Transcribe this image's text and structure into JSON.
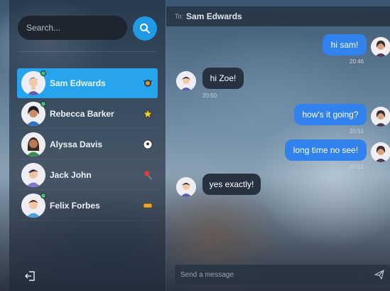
{
  "search": {
    "placeholder": "Search..."
  },
  "contacts": [
    {
      "name": "Sam Edwards",
      "active": true,
      "online": true,
      "emoji": "bug-icon"
    },
    {
      "name": "Rebecca Barker",
      "active": false,
      "online": true,
      "emoji": "star-icon"
    },
    {
      "name": "Alyssa Davis",
      "active": false,
      "online": false,
      "emoji": "soccer-ball-icon"
    },
    {
      "name": "Jack John",
      "active": false,
      "online": false,
      "emoji": "pin-icon"
    },
    {
      "name": "Felix Forbes",
      "active": false,
      "online": true,
      "emoji": "ticket-icon"
    }
  ],
  "chat": {
    "to_label": "To:",
    "to_name": "Sam Edwards",
    "messages": [
      {
        "text": "hi sam!",
        "time": "20:46",
        "direction": "out"
      },
      {
        "text": "hi Zoe!",
        "time": "20:50",
        "direction": "in"
      },
      {
        "text": "how's it going?",
        "time": "20:51",
        "direction": "out"
      },
      {
        "text": "long time no see!",
        "time": "20:51",
        "direction": "out"
      },
      {
        "text": "yes exactly!",
        "time": "",
        "direction": "in"
      }
    ],
    "composer_placeholder": "Send a message"
  },
  "colors": {
    "accent": "#27a4ee",
    "out_bubble": "#3182ec",
    "in_bubble": "#263240",
    "online": "#3ec177"
  }
}
